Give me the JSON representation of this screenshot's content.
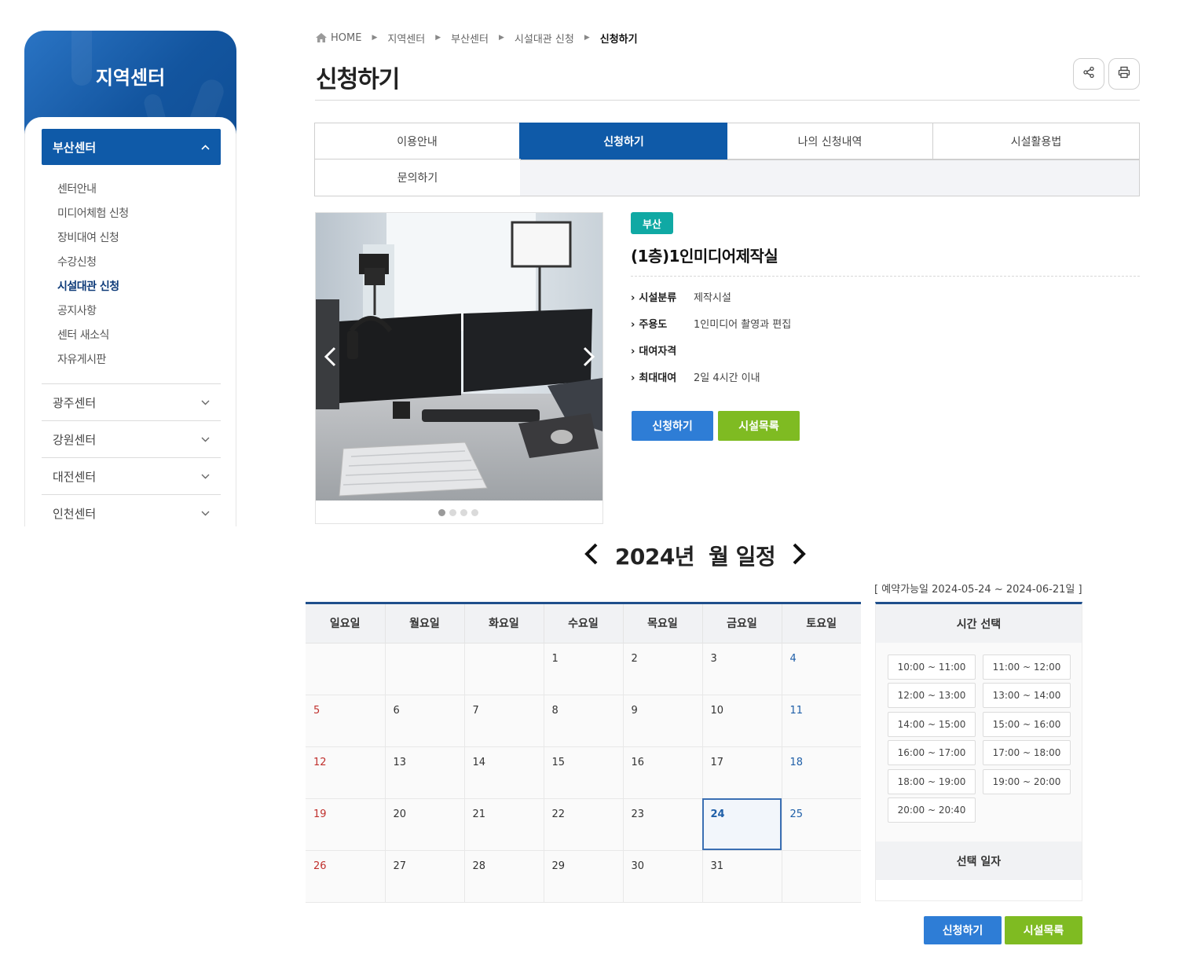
{
  "sidebar": {
    "title": "지역센터",
    "active_center": "부산센터",
    "sub_items": [
      "센터안내",
      "미디어체험 신청",
      "장비대여 신청",
      "수강신청",
      "시설대관 신청",
      "공지사항",
      "센터 새소식",
      "자유게시판"
    ],
    "current_sub": "시설대관 신청",
    "other_centers": [
      "광주센터",
      "강원센터",
      "대전센터",
      "인천센터"
    ]
  },
  "breadcrumb": [
    "HOME",
    "지역센터",
    "부산센터",
    "시설대관 신청",
    "신청하기"
  ],
  "page_title": "신청하기",
  "header_icons": [
    "share-icon",
    "print-icon"
  ],
  "tabs": [
    "이용안내",
    "신청하기",
    "나의 신청내역",
    "시설활용법",
    "문의하기"
  ],
  "active_tab": "신청하기",
  "facility": {
    "badge": "부산",
    "name": "(1층)1인미디어제작실",
    "info": [
      {
        "label": "시설분류",
        "value": "제작시설"
      },
      {
        "label": "주용도",
        "value": "1인미디어 촬영과 편집"
      },
      {
        "label": "대여자격",
        "value": ""
      },
      {
        "label": "최대대여",
        "value": "2일 4시간 이내"
      }
    ],
    "apply_label": "신청하기",
    "list_label": "시설목록",
    "slider_dots": 4,
    "slider_active": 1
  },
  "calendar": {
    "year_label": "2024년",
    "month_label": "월 일정",
    "available": "[ 예약가능일 2024-05-24 ~ 2024-06-21일 ]",
    "weekdays": [
      "일요일",
      "월요일",
      "화요일",
      "수요일",
      "목요일",
      "금요일",
      "토요일"
    ],
    "weeks": [
      [
        "",
        "",
        "",
        "1",
        "2",
        "3",
        "4"
      ],
      [
        "5",
        "6",
        "7",
        "8",
        "9",
        "10",
        "11"
      ],
      [
        "12",
        "13",
        "14",
        "15",
        "16",
        "17",
        "18"
      ],
      [
        "19",
        "20",
        "21",
        "22",
        "23",
        "24",
        "25"
      ],
      [
        "26",
        "27",
        "28",
        "29",
        "30",
        "31",
        ""
      ]
    ],
    "today": "24"
  },
  "time_panel": {
    "title": "시간 선택",
    "slots": [
      "10:00 ~ 11:00",
      "11:00 ~ 12:00",
      "12:00 ~ 13:00",
      "13:00 ~ 14:00",
      "14:00 ~ 15:00",
      "15:00 ~ 16:00",
      "16:00 ~ 17:00",
      "17:00 ~ 18:00",
      "18:00 ~ 19:00",
      "19:00 ~ 20:00",
      "20:00 ~ 20:40"
    ],
    "selected_date_title": "선택 일자"
  },
  "bottom_buttons": {
    "apply": "신청하기",
    "list": "시설목록"
  },
  "colors": {
    "primary": "#0f5aa8",
    "apply_button": "#2e7dd6",
    "list_button": "#7fbb22",
    "badge": "#10a9a4",
    "sunday": "#c0302d",
    "saturday": "#1f5fa8"
  }
}
